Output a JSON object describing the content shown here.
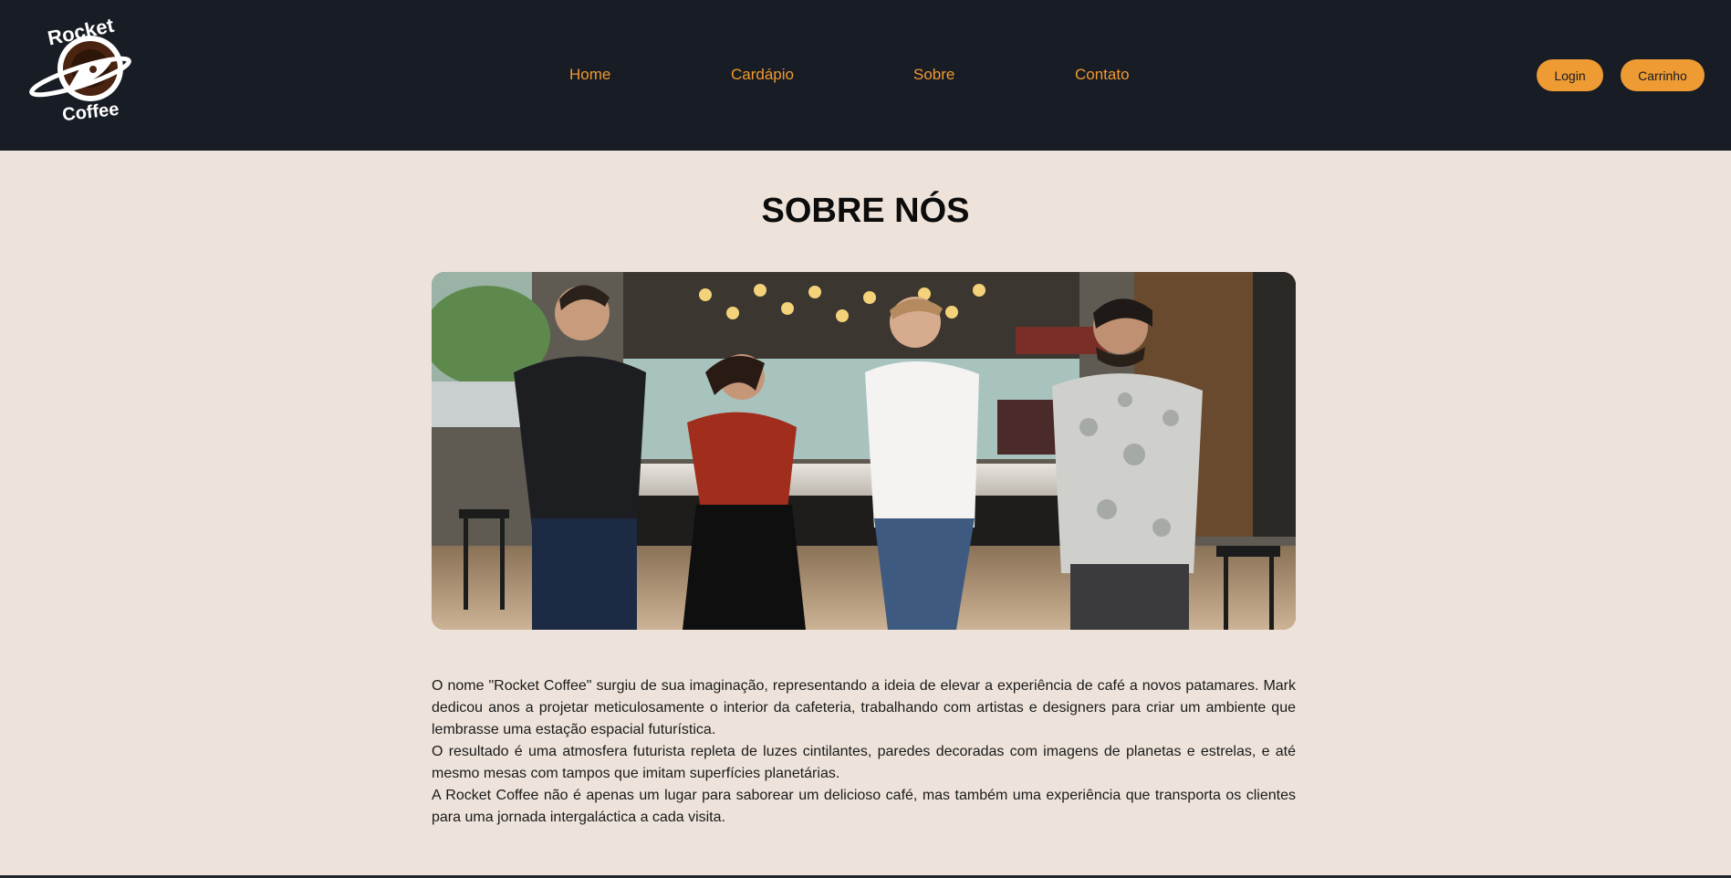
{
  "brand": {
    "name_top": "Rocket",
    "name_bottom": "Coffee",
    "accent": "#f0992f",
    "header_bg": "#181c25",
    "page_bg": "#ede3da"
  },
  "nav": {
    "items": [
      {
        "label": "Home"
      },
      {
        "label": "Cardápio"
      },
      {
        "label": "Sobre"
      },
      {
        "label": "Contato"
      }
    ]
  },
  "actions": {
    "login_label": "Login",
    "cart_label": "Carrinho"
  },
  "main": {
    "title": "SOBRE NÓS",
    "photo_icon": "team-photo",
    "paragraphs": [
      "O nome \"Rocket Coffee\" surgiu de sua imaginação, representando a ideia de elevar a experiência de café a novos patamares. Mark dedicou anos a projetar meticulosamente o interior da cafeteria, trabalhando com artistas e designers para criar um ambiente que lembrasse uma estação espacial futurística.",
      "O resultado é uma atmosfera futurista repleta de luzes cintilantes, paredes decoradas com imagens de planetas e estrelas, e até mesmo mesas com tampos que imitam superfícies planetárias.",
      "A Rocket Coffee não é apenas um lugar para saborear um delicioso café, mas também uma experiência que transporta os clientes para uma jornada intergaláctica a cada visita."
    ]
  }
}
